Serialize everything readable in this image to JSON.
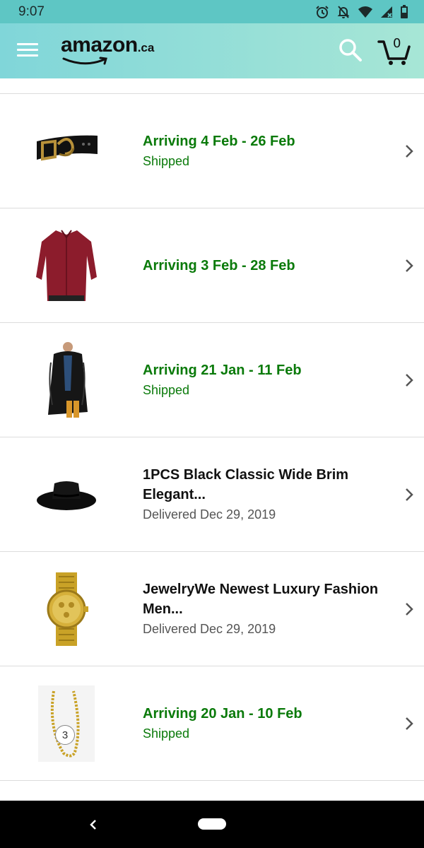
{
  "status_bar": {
    "time": "9:07",
    "icons": [
      "alarm-icon",
      "notifications-off-icon",
      "wifi-icon",
      "cell-signal-icon",
      "battery-icon"
    ]
  },
  "header": {
    "logo_text": "amazon",
    "logo_suffix": ".ca",
    "cart_count": "0",
    "icons": [
      "menu-icon",
      "search-icon",
      "cart-icon"
    ]
  },
  "orders": [
    {
      "title": "Arriving 4 Feb - 26 Feb",
      "subtitle": "Shipped",
      "status": "arriving",
      "image": "belt"
    },
    {
      "title": "Arriving 3 Feb - 28 Feb",
      "subtitle": "",
      "status": "arriving",
      "image": "red-shirt"
    },
    {
      "title": "Arriving 21 Jan - 11 Feb",
      "subtitle": "Shipped",
      "status": "arriving",
      "image": "fur-coat"
    },
    {
      "title": "1PCS Black Classic Wide Brim Elegant...",
      "subtitle": "Delivered Dec 29, 2019",
      "status": "delivered",
      "image": "black-hat"
    },
    {
      "title": "JewelryWe Newest Luxury Fashion Men...",
      "subtitle": "Delivered Dec 29, 2019",
      "status": "delivered",
      "image": "gold-watch"
    },
    {
      "title": "Arriving 20 Jan - 10 Feb",
      "subtitle": "Shipped",
      "status": "arriving",
      "image": "gold-chain",
      "quantity": "3"
    }
  ],
  "colors": {
    "status_bar": "#5ec6c4",
    "header_start": "#80d6d9",
    "header_end": "#a7e6d6",
    "arriving_text": "#0a7a0a",
    "delivered_text": "#555555"
  }
}
